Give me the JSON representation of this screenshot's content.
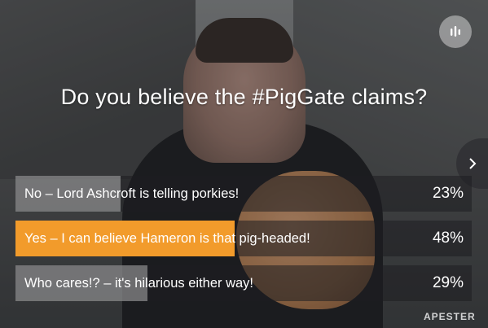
{
  "poll": {
    "question": "Do you believe the #PigGate claims?",
    "answers": [
      {
        "label": "No – Lord Ashcroft is telling porkies!",
        "percent_text": "23%",
        "percent": 23,
        "selected": false
      },
      {
        "label": "Yes – I can believe Hameron is that pig-headed!",
        "percent_text": "48%",
        "percent": 48,
        "selected": true
      },
      {
        "label": "Who cares!? – it's hilarious either way!",
        "percent_text": "29%",
        "percent": 29,
        "selected": false
      }
    ]
  },
  "brand": {
    "name": "APESTER"
  },
  "icons": {
    "stats": "bar-chart-icon",
    "next": "chevron-right-icon"
  },
  "colors": {
    "selected_fill": "#f29b2b",
    "result_fill": "#dcdcdc"
  }
}
